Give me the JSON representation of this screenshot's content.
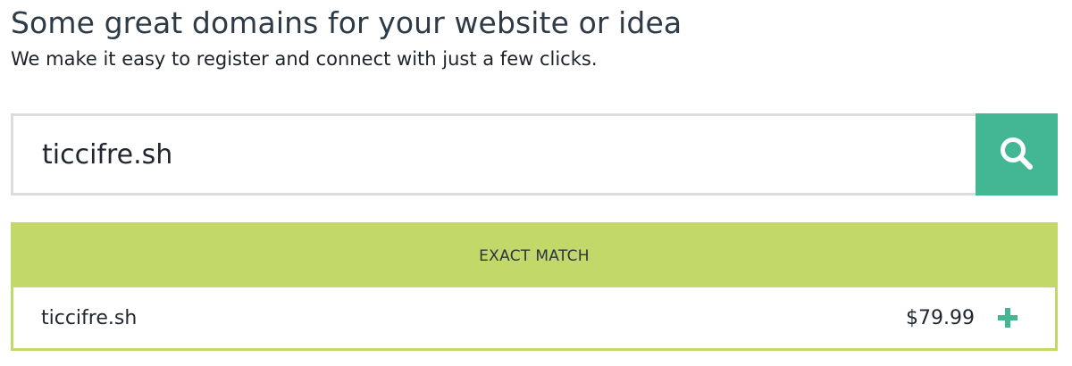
{
  "header": {
    "title": "Some great domains for your website or idea",
    "subtitle": "We make it easy to register and connect with just a few clicks."
  },
  "search": {
    "value": "ticcifre.sh",
    "button_icon": "search-icon",
    "accent_color": "#43b693"
  },
  "results": {
    "section_label": "EXACT MATCH",
    "section_color": "#c2d969",
    "items": [
      {
        "domain": "ticcifre.sh",
        "price": "$79.99",
        "action_icon": "plus-icon"
      }
    ]
  }
}
